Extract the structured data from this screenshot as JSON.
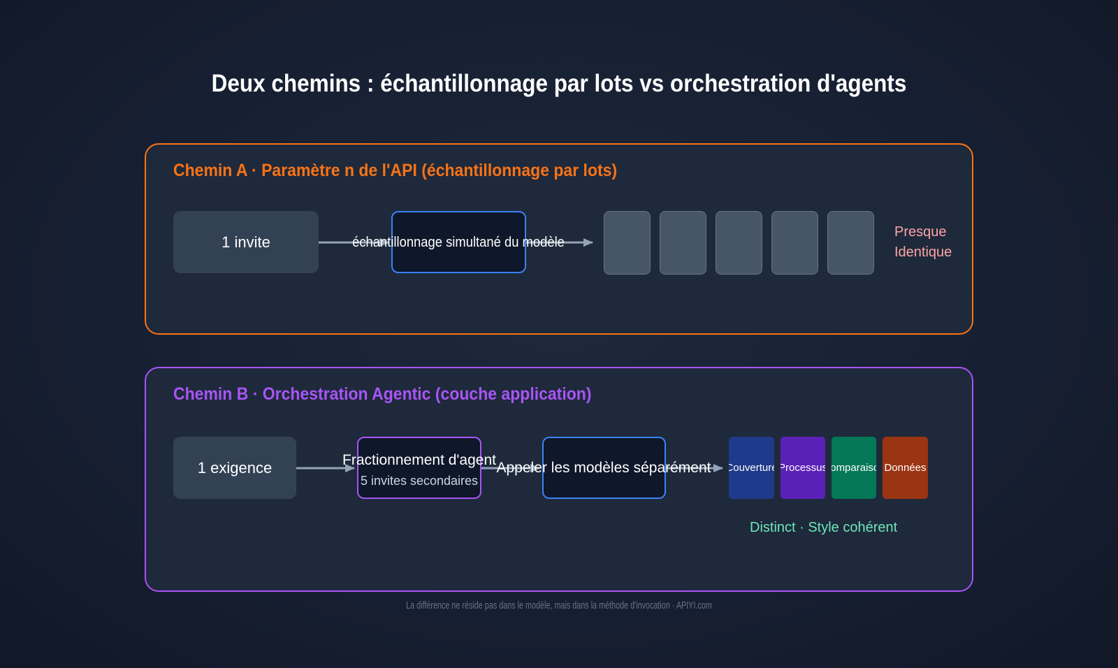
{
  "title": "Deux chemins : échantillonnage par lots vs orchestration d'agents",
  "path_a": {
    "title": "Chemin A · Paramètre n de l'API (échantillonnage par lots)",
    "input": "1 invite",
    "process": "échantillonnage simultané du modèle",
    "result_line1": "Presque",
    "result_line2": "Identique",
    "output_count": 5
  },
  "path_b": {
    "title": "Chemin B · Orchestration Agentic (couche application)",
    "input": "1 exigence",
    "split_label": "Fractionnement d'agent",
    "split_sub": "5 invites secondaires",
    "call_label": "Appeler les modèles séparément",
    "outputs": [
      {
        "label": "Couverture",
        "color": "#1e3a8a"
      },
      {
        "label": "Processus",
        "color": "#5b21b6"
      },
      {
        "label": "Comparaison",
        "color": "#047857"
      },
      {
        "label": "Données",
        "color": "#9a3412"
      }
    ],
    "result": "Distinct · Style cohérent"
  },
  "footer": "La différence ne réside pas dans le modèle, mais dans la méthode d'invocation · APIYI.com",
  "colors": {
    "path_a_accent": "#f97316",
    "path_b_accent": "#a855f7",
    "process_border": "#3b82f6",
    "result_a": "#fca5a5",
    "result_b": "#6ee7b7"
  }
}
